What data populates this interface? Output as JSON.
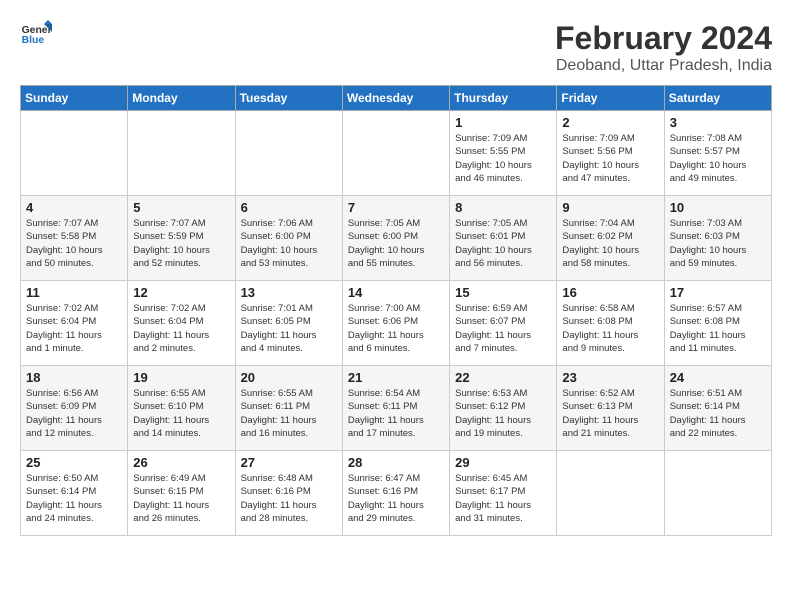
{
  "logo": {
    "line1": "General",
    "line2": "Blue"
  },
  "title": "February 2024",
  "location": "Deoband, Uttar Pradesh, India",
  "days_of_week": [
    "Sunday",
    "Monday",
    "Tuesday",
    "Wednesday",
    "Thursday",
    "Friday",
    "Saturday"
  ],
  "weeks": [
    [
      {
        "num": "",
        "info": ""
      },
      {
        "num": "",
        "info": ""
      },
      {
        "num": "",
        "info": ""
      },
      {
        "num": "",
        "info": ""
      },
      {
        "num": "1",
        "info": "Sunrise: 7:09 AM\nSunset: 5:55 PM\nDaylight: 10 hours\nand 46 minutes."
      },
      {
        "num": "2",
        "info": "Sunrise: 7:09 AM\nSunset: 5:56 PM\nDaylight: 10 hours\nand 47 minutes."
      },
      {
        "num": "3",
        "info": "Sunrise: 7:08 AM\nSunset: 5:57 PM\nDaylight: 10 hours\nand 49 minutes."
      }
    ],
    [
      {
        "num": "4",
        "info": "Sunrise: 7:07 AM\nSunset: 5:58 PM\nDaylight: 10 hours\nand 50 minutes."
      },
      {
        "num": "5",
        "info": "Sunrise: 7:07 AM\nSunset: 5:59 PM\nDaylight: 10 hours\nand 52 minutes."
      },
      {
        "num": "6",
        "info": "Sunrise: 7:06 AM\nSunset: 6:00 PM\nDaylight: 10 hours\nand 53 minutes."
      },
      {
        "num": "7",
        "info": "Sunrise: 7:05 AM\nSunset: 6:00 PM\nDaylight: 10 hours\nand 55 minutes."
      },
      {
        "num": "8",
        "info": "Sunrise: 7:05 AM\nSunset: 6:01 PM\nDaylight: 10 hours\nand 56 minutes."
      },
      {
        "num": "9",
        "info": "Sunrise: 7:04 AM\nSunset: 6:02 PM\nDaylight: 10 hours\nand 58 minutes."
      },
      {
        "num": "10",
        "info": "Sunrise: 7:03 AM\nSunset: 6:03 PM\nDaylight: 10 hours\nand 59 minutes."
      }
    ],
    [
      {
        "num": "11",
        "info": "Sunrise: 7:02 AM\nSunset: 6:04 PM\nDaylight: 11 hours\nand 1 minute."
      },
      {
        "num": "12",
        "info": "Sunrise: 7:02 AM\nSunset: 6:04 PM\nDaylight: 11 hours\nand 2 minutes."
      },
      {
        "num": "13",
        "info": "Sunrise: 7:01 AM\nSunset: 6:05 PM\nDaylight: 11 hours\nand 4 minutes."
      },
      {
        "num": "14",
        "info": "Sunrise: 7:00 AM\nSunset: 6:06 PM\nDaylight: 11 hours\nand 6 minutes."
      },
      {
        "num": "15",
        "info": "Sunrise: 6:59 AM\nSunset: 6:07 PM\nDaylight: 11 hours\nand 7 minutes."
      },
      {
        "num": "16",
        "info": "Sunrise: 6:58 AM\nSunset: 6:08 PM\nDaylight: 11 hours\nand 9 minutes."
      },
      {
        "num": "17",
        "info": "Sunrise: 6:57 AM\nSunset: 6:08 PM\nDaylight: 11 hours\nand 11 minutes."
      }
    ],
    [
      {
        "num": "18",
        "info": "Sunrise: 6:56 AM\nSunset: 6:09 PM\nDaylight: 11 hours\nand 12 minutes."
      },
      {
        "num": "19",
        "info": "Sunrise: 6:55 AM\nSunset: 6:10 PM\nDaylight: 11 hours\nand 14 minutes."
      },
      {
        "num": "20",
        "info": "Sunrise: 6:55 AM\nSunset: 6:11 PM\nDaylight: 11 hours\nand 16 minutes."
      },
      {
        "num": "21",
        "info": "Sunrise: 6:54 AM\nSunset: 6:11 PM\nDaylight: 11 hours\nand 17 minutes."
      },
      {
        "num": "22",
        "info": "Sunrise: 6:53 AM\nSunset: 6:12 PM\nDaylight: 11 hours\nand 19 minutes."
      },
      {
        "num": "23",
        "info": "Sunrise: 6:52 AM\nSunset: 6:13 PM\nDaylight: 11 hours\nand 21 minutes."
      },
      {
        "num": "24",
        "info": "Sunrise: 6:51 AM\nSunset: 6:14 PM\nDaylight: 11 hours\nand 22 minutes."
      }
    ],
    [
      {
        "num": "25",
        "info": "Sunrise: 6:50 AM\nSunset: 6:14 PM\nDaylight: 11 hours\nand 24 minutes."
      },
      {
        "num": "26",
        "info": "Sunrise: 6:49 AM\nSunset: 6:15 PM\nDaylight: 11 hours\nand 26 minutes."
      },
      {
        "num": "27",
        "info": "Sunrise: 6:48 AM\nSunset: 6:16 PM\nDaylight: 11 hours\nand 28 minutes."
      },
      {
        "num": "28",
        "info": "Sunrise: 6:47 AM\nSunset: 6:16 PM\nDaylight: 11 hours\nand 29 minutes."
      },
      {
        "num": "29",
        "info": "Sunrise: 6:45 AM\nSunset: 6:17 PM\nDaylight: 11 hours\nand 31 minutes."
      },
      {
        "num": "",
        "info": ""
      },
      {
        "num": "",
        "info": ""
      }
    ]
  ]
}
